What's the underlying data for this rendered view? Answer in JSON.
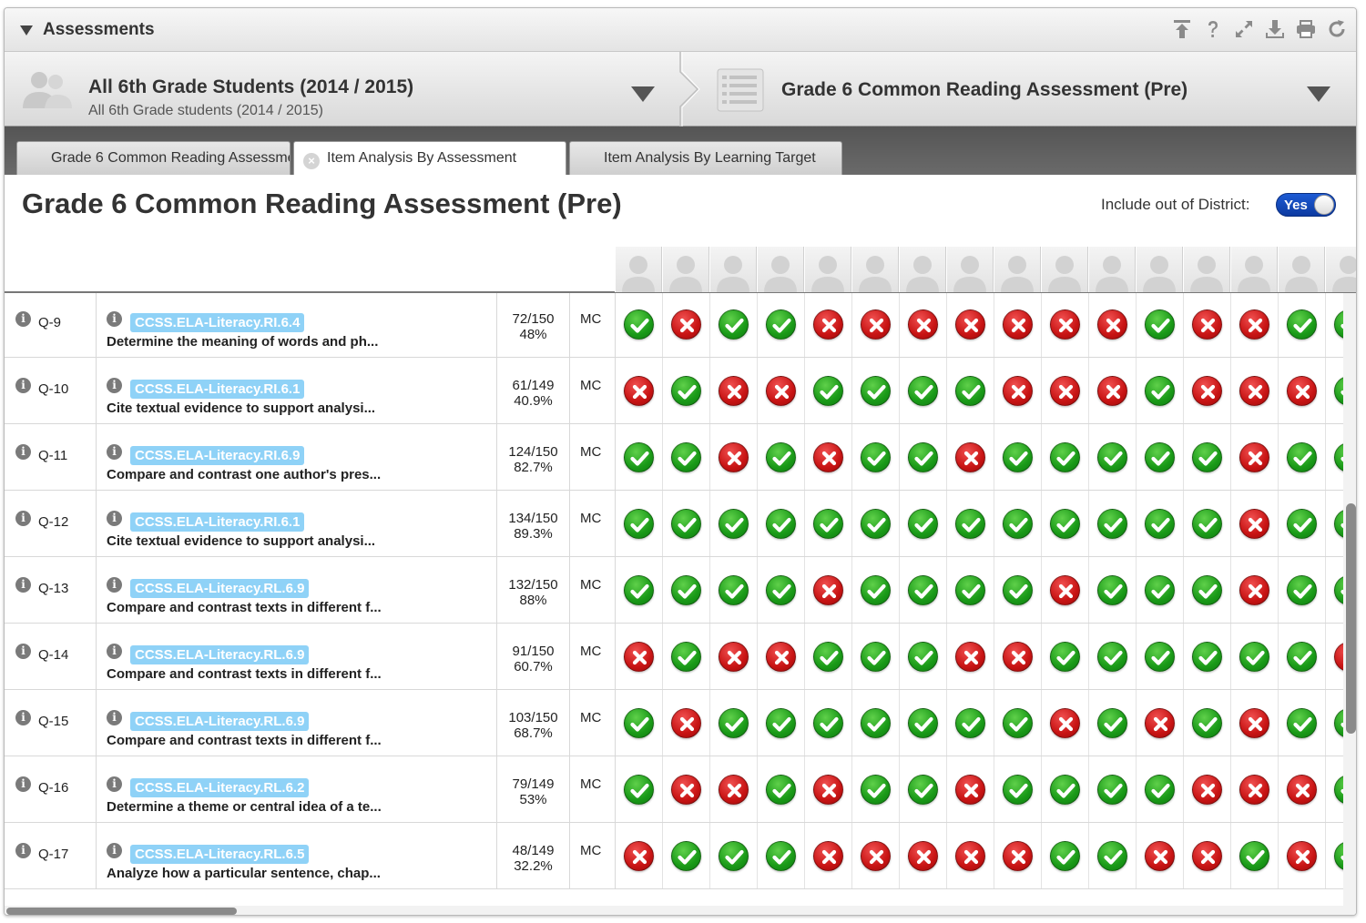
{
  "panel": {
    "title": "Assessments",
    "toolbar_icons": [
      "upload-icon",
      "help-icon",
      "expand-icon",
      "download-icon",
      "print-icon",
      "refresh-icon"
    ]
  },
  "selector": {
    "student_group_title": "All 6th Grade Students (2014 / 2015)",
    "student_group_subtitle": "All 6th Grade students (2014 / 2015)",
    "assessment_title": "Grade 6 Common Reading Assessment (Pre)"
  },
  "tabs": [
    {
      "label": "Grade 6 Common Reading Assessment (Pre)"
    },
    {
      "label": "Item Analysis By Assessment"
    },
    {
      "label": "Item Analysis By Learning Target"
    }
  ],
  "heading": {
    "title": "Grade 6 Common Reading Assessment (Pre)",
    "out_of_district_label": "Include out of District:",
    "out_of_district_value": "Yes"
  },
  "colors": {
    "correct": "#1a9a18",
    "incorrect": "#c81414",
    "standard_badge": "#8fd2f7",
    "toggle": "#1d5bd4"
  },
  "rows": [
    {
      "q": "Q-9",
      "standard": "CCSS.ELA-Literacy.RI.6.4",
      "desc": "Determine the meaning of words and ph...",
      "fraction": "72/150",
      "percent": "48%",
      "type": "MC",
      "marks": "1011000000010011"
    },
    {
      "q": "Q-10",
      "standard": "CCSS.ELA-Literacy.RI.6.1",
      "desc": "Cite textual evidence to support analysi...",
      "fraction": "61/149",
      "percent": "40.9%",
      "type": "MC",
      "marks": "0100111100010001"
    },
    {
      "q": "Q-11",
      "standard": "CCSS.ELA-Literacy.RI.6.9",
      "desc": "Compare and contrast one author's pres...",
      "fraction": "124/150",
      "percent": "82.7%",
      "type": "MC",
      "marks": "1101011011111011"
    },
    {
      "q": "Q-12",
      "standard": "CCSS.ELA-Literacy.RI.6.1",
      "desc": "Cite textual evidence to support analysi...",
      "fraction": "134/150",
      "percent": "89.3%",
      "type": "MC",
      "marks": "1111111111111011"
    },
    {
      "q": "Q-13",
      "standard": "CCSS.ELA-Literacy.RL.6.9",
      "desc": "Compare and contrast texts in different f...",
      "fraction": "132/150",
      "percent": "88%",
      "type": "MC",
      "marks": "1111011110111011"
    },
    {
      "q": "Q-14",
      "standard": "CCSS.ELA-Literacy.RL.6.9",
      "desc": "Compare and contrast texts in different f...",
      "fraction": "91/150",
      "percent": "60.7%",
      "type": "MC",
      "marks": "0100111001111110"
    },
    {
      "q": "Q-15",
      "standard": "CCSS.ELA-Literacy.RL.6.9",
      "desc": "Compare and contrast texts in different f...",
      "fraction": "103/150",
      "percent": "68.7%",
      "type": "MC",
      "marks": "1011111110101011"
    },
    {
      "q": "Q-16",
      "standard": "CCSS.ELA-Literacy.RL.6.2",
      "desc": "Determine a theme or central idea of a te...",
      "fraction": "79/149",
      "percent": "53%",
      "type": "MC",
      "marks": "1001011011110001"
    },
    {
      "q": "Q-17",
      "standard": "CCSS.ELA-Literacy.RL.6.5",
      "desc": "Analyze how a particular sentence, chap...",
      "fraction": "48/149",
      "percent": "32.2%",
      "type": "MC",
      "marks": "0111000001100101"
    }
  ]
}
